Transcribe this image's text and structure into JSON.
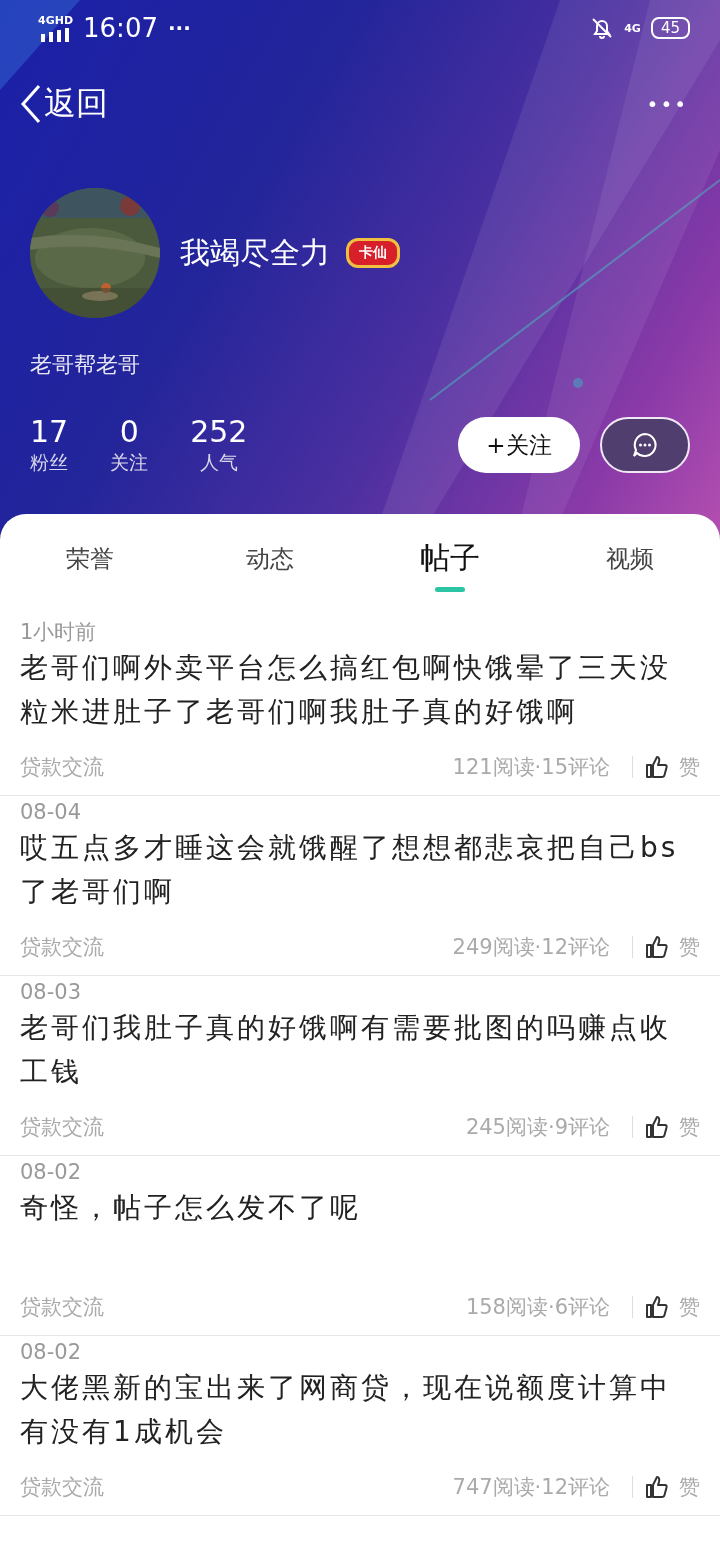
{
  "status_bar": {
    "network": "4GHD",
    "time": "16:07",
    "more": "···",
    "mobile": "4G",
    "battery": "45"
  },
  "nav": {
    "back": "返回",
    "more": "•••"
  },
  "profile": {
    "name": "我竭尽全力",
    "badge": "卡仙",
    "bio": "老哥帮老哥",
    "stats": [
      {
        "value": "17",
        "label": "粉丝"
      },
      {
        "value": "0",
        "label": "关注"
      },
      {
        "value": "252",
        "label": "人气"
      }
    ],
    "follow_button": "+关注"
  },
  "tabs": [
    {
      "label": "荣誉",
      "selected": false
    },
    {
      "label": "动态",
      "selected": false
    },
    {
      "label": "帖子",
      "selected": true
    },
    {
      "label": "视频",
      "selected": false
    }
  ],
  "posts": [
    {
      "time": "1小时前",
      "title": "老哥们啊外卖平台怎么搞红包啊快饿晕了三天没粒米进肚子了老哥们啊我肚子真的好饿啊",
      "category": "贷款交流",
      "stats": "121阅读·15评论",
      "like": "赞"
    },
    {
      "time": "08-04",
      "title": "哎五点多才睡这会就饿醒了想想都悲哀把自己bs了老哥们啊",
      "category": "贷款交流",
      "stats": "249阅读·12评论",
      "like": "赞"
    },
    {
      "time": "08-03",
      "title": "老哥们我肚子真的好饿啊有需要批图的吗赚点收工钱",
      "category": "贷款交流",
      "stats": "245阅读·9评论",
      "like": "赞"
    },
    {
      "time": "08-02",
      "title": "奇怪，帖子怎么发不了呢",
      "category": "贷款交流",
      "stats": "158阅读·6评论",
      "like": "赞"
    },
    {
      "time": "08-02",
      "title": "大佬黑新的宝出来了网商贷，现在说额度计算中有没有1成机会",
      "category": "贷款交流",
      "stats": "747阅读·12评论",
      "like": "赞"
    }
  ]
}
